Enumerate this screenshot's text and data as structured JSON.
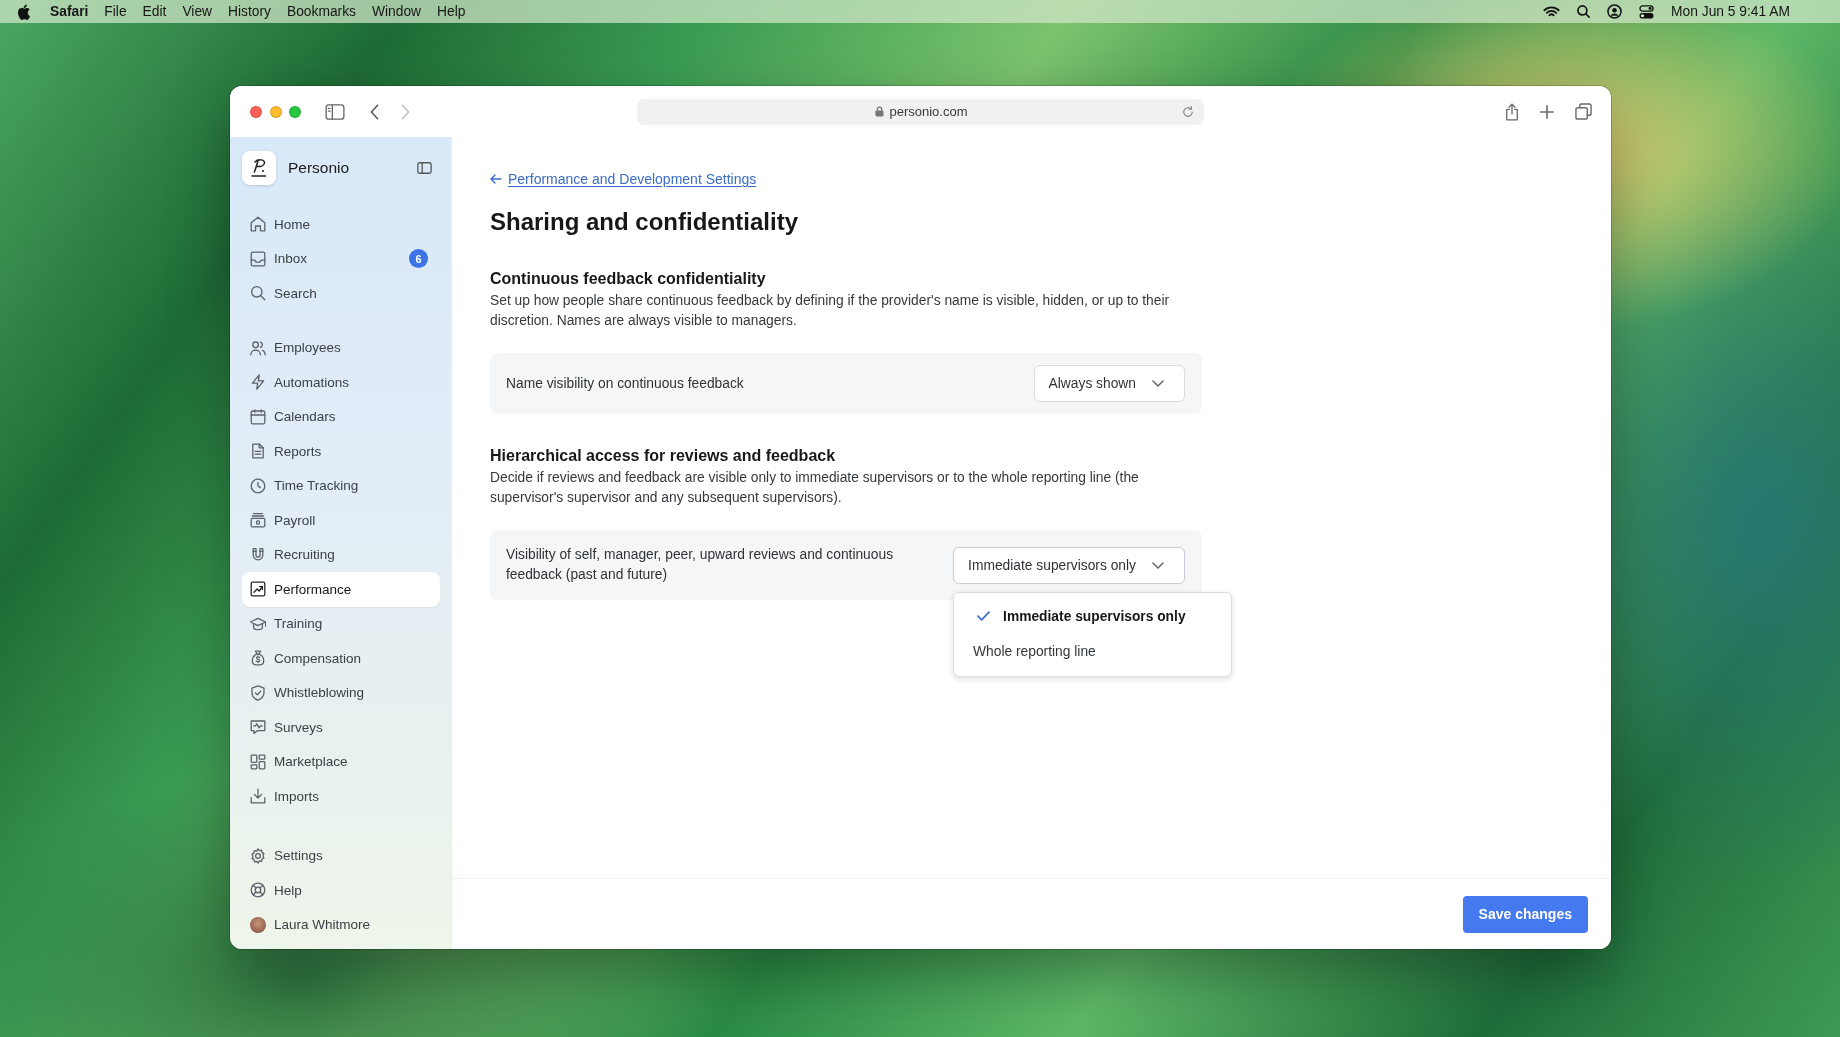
{
  "menu_bar": {
    "app": "Safari",
    "menus": [
      "File",
      "Edit",
      "View",
      "History",
      "Bookmarks",
      "Window",
      "Help"
    ],
    "clock": "Mon Jun 5 9:41 AM"
  },
  "browser": {
    "url": "personio.com",
    "back": {
      "disabled": false
    },
    "forward": {
      "disabled": true
    }
  },
  "sidebar": {
    "brand": "Personio",
    "groups": [
      {
        "items": [
          {
            "label": "Home",
            "selected": false
          },
          {
            "label": "Inbox",
            "selected": false,
            "badge": "6"
          },
          {
            "label": "Search",
            "selected": false
          }
        ]
      },
      {
        "items": [
          {
            "label": "Employees",
            "selected": false
          },
          {
            "label": "Automations",
            "selected": false
          },
          {
            "label": "Calendars",
            "selected": false
          },
          {
            "label": "Reports",
            "selected": false
          },
          {
            "label": "Time Tracking",
            "selected": false
          },
          {
            "label": "Payroll",
            "selected": false
          },
          {
            "label": "Recruiting",
            "selected": false
          },
          {
            "label": "Performance",
            "selected": true
          },
          {
            "label": "Training",
            "selected": false
          },
          {
            "label": "Compensation",
            "selected": false
          },
          {
            "label": "Whistleblowing",
            "selected": false
          },
          {
            "label": "Surveys",
            "selected": false
          },
          {
            "label": "Marketplace",
            "selected": false
          },
          {
            "label": "Imports",
            "selected": false
          }
        ]
      },
      {
        "items": [
          {
            "label": "Settings",
            "selected": false
          },
          {
            "label": "Help",
            "selected": false
          }
        ]
      }
    ],
    "user": {
      "name": "Laura Whitmore"
    }
  },
  "page": {
    "back_link": "Performance and Development Settings",
    "title": "Sharing and confidentiality",
    "sections": [
      {
        "heading": "Continuous feedback confidentiality",
        "description": "Set up how people share continuous feedback by defining if the provider's name is visible, hidden, or up to their discretion. Names are always visible to managers.",
        "setting": {
          "label": "Name visibility on continuous feedback",
          "value": "Always shown",
          "expanded": false
        }
      },
      {
        "heading": "Hierarchical access for reviews and feedback",
        "description": "Decide if reviews and feedback are visible only to immediate supervisors or to the whole reporting line (the supervisor's supervisor and any subsequent supervisors).",
        "setting": {
          "label": "Visibility of self, manager, peer, upward reviews and continuous feedback (past and future)",
          "value": "Immediate supervisors only",
          "expanded": true,
          "options": [
            {
              "label": "Immediate supervisors only",
              "selected": true
            },
            {
              "label": "Whole reporting line",
              "selected": false
            }
          ]
        }
      }
    ]
  },
  "footer": {
    "save_button": "Save changes"
  }
}
